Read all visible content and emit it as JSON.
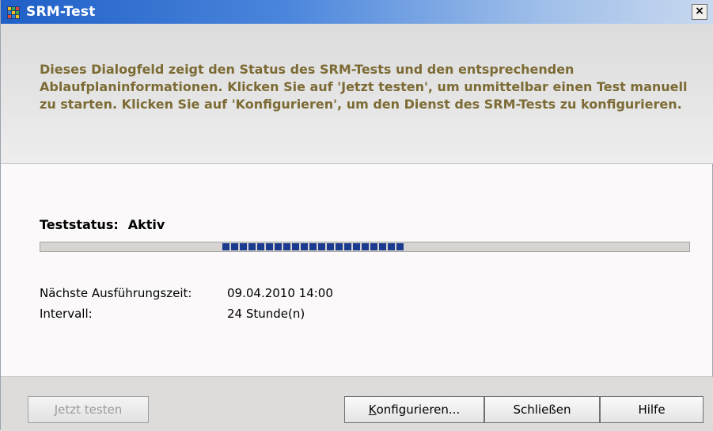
{
  "window": {
    "title": "SRM-Test",
    "close_label": "×"
  },
  "info": {
    "text": "Dieses Dialogfeld zeigt den Status des SRM-Tests und den entsprechenden Ablaufplaninformationen. Klicken Sie auf 'Jetzt testen', um unmittelbar einen Test manuell zu starten. Klicken Sie auf 'Konfigurieren', um den Dienst des SRM-Tests zu konfigurieren."
  },
  "status": {
    "label": "Teststatus:",
    "value": "Aktiv",
    "progress_color": "#1b3c8e",
    "progress_fraction_start": 0.28,
    "progress_fraction_end": 0.56
  },
  "schedule": {
    "next_run_label": "Nächste Ausführungszeit:",
    "next_run_value": "09.04.2010 14:00",
    "interval_label": "Intervall:",
    "interval_value": "24 Stunde(n)"
  },
  "buttons": {
    "test_now_prefix": "J",
    "test_now_rest": "etzt testen",
    "configure_prefix": "K",
    "configure_rest": "onfigurieren...",
    "close": "Schließen",
    "help": "Hilfe"
  },
  "icons": {
    "app": "app-grid-icon",
    "close": "close-icon"
  }
}
